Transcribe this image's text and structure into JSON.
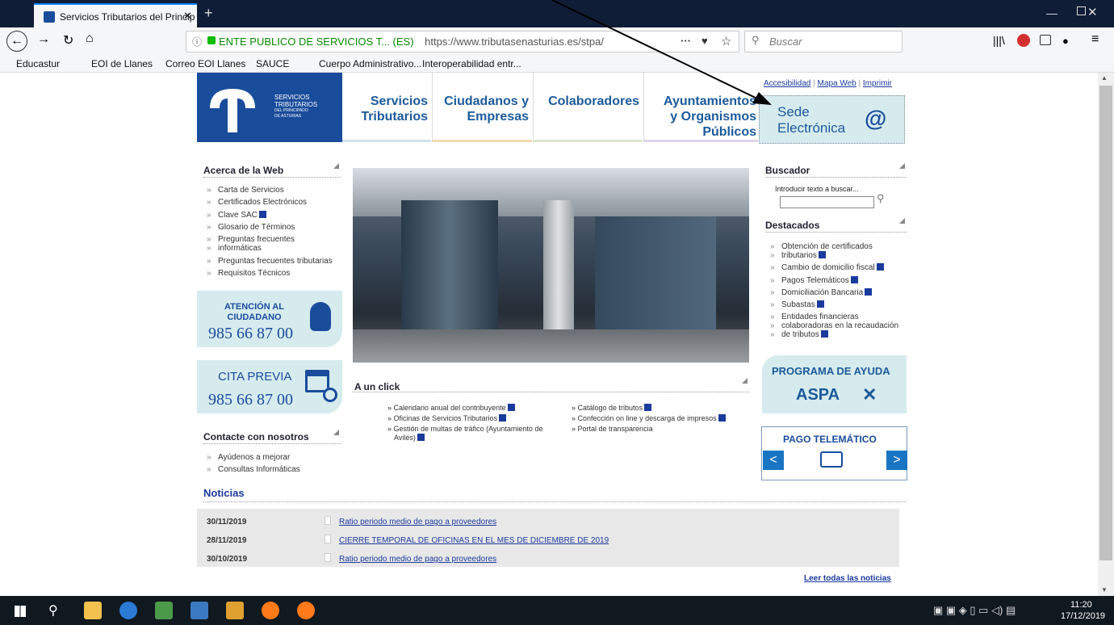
{
  "browser": {
    "tab_title": "Servicios Tributarios del Princip",
    "url_identity": "ENTE PUBLICO DE SERVICIOS T... (ES)",
    "url": "https://www.tributasenasturias.es/stpa/",
    "search_placeholder": "Buscar",
    "bookmarks": [
      "Educastur",
      "EOI de Llanes",
      "Correo EOI Llanes",
      "SAUCE",
      "Cuerpo Administrativo...",
      "Interoperabilidad entr..."
    ],
    "more": "···"
  },
  "site": {
    "logo_text": [
      "SERVICIOS",
      "TRIBUTARIOS",
      "DEL PRINCIPADO",
      "DE ASTURIAS"
    ],
    "util_links": [
      "Accesibilidad",
      "Mapa Web",
      "Imprimir"
    ],
    "nav": [
      {
        "line1": "Servicios",
        "line2": "Tributarios",
        "line3": ""
      },
      {
        "line1": "Ciudadanos y",
        "line2": "Empresas",
        "line3": ""
      },
      {
        "line1": "Colaboradores",
        "line2": "",
        "line3": ""
      },
      {
        "line1": "Ayuntamientos",
        "line2": "y Organismos",
        "line3": "Públicos"
      }
    ],
    "sede": {
      "line1": "Sede",
      "line2": "Electrónica",
      "at": "@"
    },
    "acerca": {
      "title": "Acerca de la Web",
      "items": [
        "Carta de Servicios",
        "Certificados Electrónicos",
        "Clave SAC",
        "Glosario de Términos",
        "Preguntas frecuentes",
        "informáticas",
        "Preguntas frecuentes tributarias",
        "Requisitos Técnicos"
      ]
    },
    "atencion": {
      "line1": "ATENCIÓN AL",
      "line2": "CIUDADANO",
      "phone": "985 66 87 00"
    },
    "cita": {
      "line1": "CITA PREVIA",
      "phone": "985 66 87 00"
    },
    "contacte": {
      "title": "Contacte con nosotros",
      "items": [
        "Ayúdenos a mejorar",
        "Consultas Informáticas"
      ]
    },
    "buscador": {
      "title": "Buscador",
      "label": "Introducir texto a buscar..."
    },
    "destacados": {
      "title": "Destacados",
      "items": [
        "Obtención de certificados",
        "tributarios",
        "Cambio de domicilio fiscal",
        "Pagos Telemáticos",
        "Domiciliación Bancaria",
        "Subastas",
        "Entidades financieras",
        "colaboradoras en la recaudación",
        "de tributos"
      ]
    },
    "programa": {
      "line1": "PROGRAMA DE AYUDA",
      "line2": "ASPA"
    },
    "pago": {
      "title": "PAGO TELEMÁTICO",
      "prev": "<",
      "next": ">"
    },
    "unclick": {
      "title": "A un click",
      "col1": [
        "Calendario anual del contribuyente",
        "Oficinas de Servicios Tributarios",
        "Gestión de multas de tráfico (Ayuntamiento de",
        "Avilés)"
      ],
      "col2": [
        "Catálogo de tributos",
        "Confección on line y descarga de impresos",
        "Portal de transparencia"
      ]
    },
    "noticias": {
      "title": "Noticias",
      "rows": [
        {
          "date": "30/11/2019",
          "title": "Ratio periodo medio de pago a proveedores"
        },
        {
          "date": "28/11/2019",
          "title": "CIERRE TEMPORAL DE OFICINAS EN EL MES DE DICIEMBRE DE 2019"
        },
        {
          "date": "30/10/2019",
          "title": "Ratio periodo medio de pago a proveedores"
        }
      ],
      "more": "Leer todas las noticias"
    }
  },
  "taskbar": {
    "time": "11:20",
    "date": "17/12/2019"
  },
  "colors": {
    "brand_blue": "#1a4c9c",
    "nav_blue": "#1c5a9a",
    "teal_panel": "#d6ebee"
  }
}
